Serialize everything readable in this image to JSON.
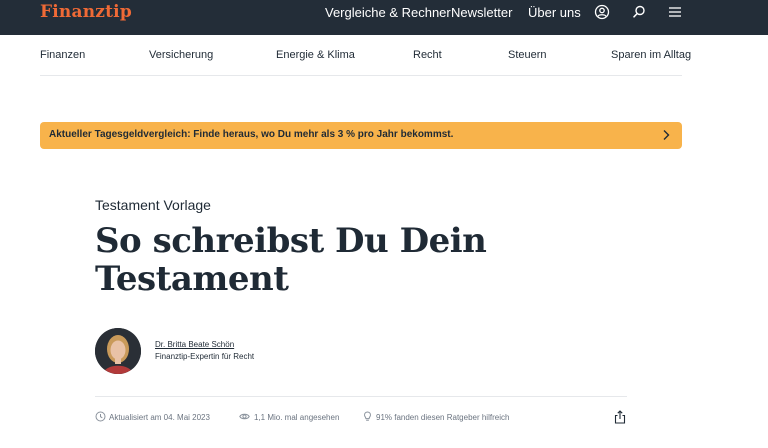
{
  "header": {
    "logo": "Finanztip",
    "nav": [
      "Vergleiche & Rechner",
      "Newsletter",
      "Über uns"
    ],
    "icons": [
      "user-icon",
      "search-icon",
      "menu-icon"
    ],
    "colors": {
      "bar": "#232d38",
      "logo": "#f06a36"
    }
  },
  "categories": [
    "Finanzen",
    "Versicherung",
    "Energie & Klima",
    "Recht",
    "Steuern",
    "Sparen im Alltag"
  ],
  "banner": {
    "text": "Aktueller Tagesgeldvergleich: Finde heraus, wo Du mehr als 3 % pro Jahr bekommst.",
    "color": "#f8b34b"
  },
  "article": {
    "kicker": "Testament Vorlage",
    "title": "So schreibst Du Dein Testament",
    "author": {
      "name": "Dr. Britta Beate Schön",
      "role": "Finanztip-Expertin für Recht"
    },
    "meta": {
      "updated": "Aktualisiert am 04. Mai 2023",
      "views": "1,1 Mio. mal angesehen",
      "helpful": "91% fanden diesen Ratgeber hilfreich"
    }
  }
}
